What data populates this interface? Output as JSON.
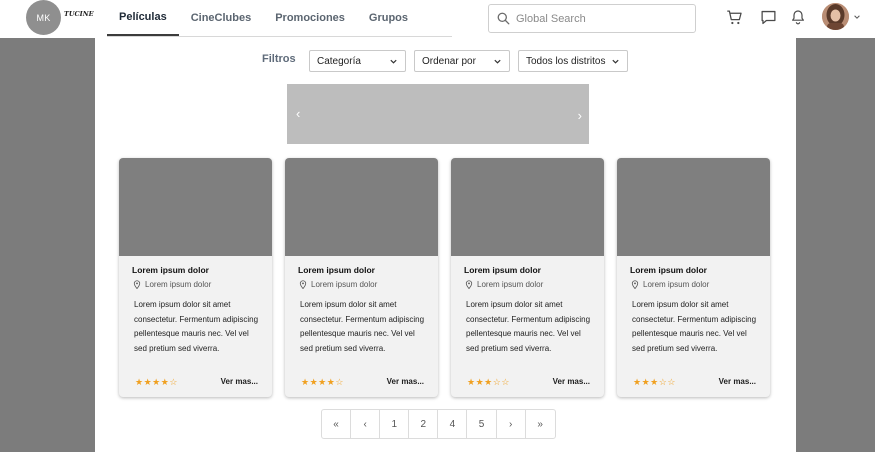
{
  "header": {
    "logo_initials": "MK",
    "logo_text": "TUCINE",
    "nav": [
      {
        "label": "Películas",
        "active": true
      },
      {
        "label": "CineClubes",
        "active": false
      },
      {
        "label": "Promociones",
        "active": false
      },
      {
        "label": "Grupos",
        "active": false
      }
    ],
    "search_placeholder": "Global Search",
    "icons": [
      "cart-icon",
      "message-icon",
      "bell-icon"
    ]
  },
  "filters": {
    "label": "Filtros",
    "selects": [
      "Categoría",
      "Ordenar por",
      "Todos los distritos"
    ]
  },
  "carousel": {
    "prev": "‹",
    "next": "›"
  },
  "cards": [
    {
      "title": "Lorem ipsum dolor",
      "location": "Lorem ipsum dolor",
      "description": "Lorem ipsum dolor sit amet consectetur. Fermentum adipiscing pellentesque mauris nec. Vel vel sed pretium sed viverra.",
      "rating": 4,
      "more": "Ver mas..."
    },
    {
      "title": "Lorem ipsum dolor",
      "location": "Lorem ipsum dolor",
      "description": "Lorem ipsum dolor sit amet consectetur. Fermentum adipiscing pellentesque mauris nec. Vel vel sed pretium sed viverra.",
      "rating": 4,
      "more": "Ver mas..."
    },
    {
      "title": "Lorem ipsum dolor",
      "location": "Lorem ipsum dolor",
      "description": "Lorem ipsum dolor sit amet consectetur. Fermentum adipiscing pellentesque mauris nec. Vel vel sed pretium sed viverra.",
      "rating": 3,
      "more": "Ver mas..."
    },
    {
      "title": "Lorem ipsum dolor",
      "location": "Lorem ipsum dolor",
      "description": "Lorem ipsum dolor sit amet consectetur. Fermentum adipiscing pellentesque mauris nec. Vel vel sed pretium sed viverra.",
      "rating": 3,
      "more": "Ver mas..."
    }
  ],
  "pagination": [
    "«",
    "‹",
    "1",
    "2",
    "4",
    "5",
    "›",
    "»"
  ],
  "colors": {
    "star": "#f0a020",
    "placeholder_image": "#7f7f7f",
    "backdrop": "#7c7c7c"
  }
}
